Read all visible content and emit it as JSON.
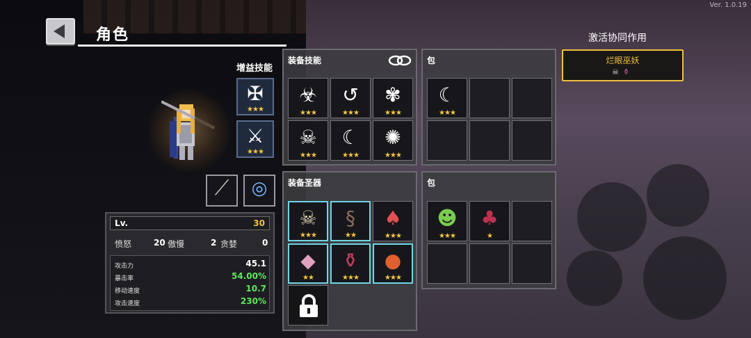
{
  "version": "Ver. 1.0.19",
  "header": {
    "title": "角色"
  },
  "buff": {
    "label": "增益技能",
    "slots": [
      {
        "icon": "demon-sigil-icon",
        "glyph": "✠",
        "stars": "★★★"
      },
      {
        "icon": "sword-arrow-icon",
        "glyph": "⚔",
        "stars": "★★★"
      }
    ]
  },
  "equipped": [
    {
      "icon": "spear-icon",
      "glyph": "⟋"
    },
    {
      "icon": "whirl-shield-icon",
      "glyph": "◎"
    }
  ],
  "stats": {
    "lv_label": "Lv.",
    "lv_value": "30",
    "traits": [
      {
        "name": "愤怒",
        "value": "20"
      },
      {
        "name": "傲慢",
        "value": "2"
      },
      {
        "name": "贪婪",
        "value": "0"
      }
    ],
    "rows": [
      {
        "name": "攻击力",
        "value": "45.1",
        "color": "#ffffff"
      },
      {
        "name": "暴击率",
        "value": "54.00%",
        "color": "#5ee65e"
      },
      {
        "name": "移动速度",
        "value": "10.7",
        "color": "#5ee65e"
      },
      {
        "name": "攻击速度",
        "value": "230%",
        "color": "#5ee65e"
      }
    ]
  },
  "skills_panel": {
    "title": "装备技能",
    "slots": [
      {
        "icon": "biohazard-icon",
        "glyph": "☣",
        "stars": "★★★"
      },
      {
        "icon": "axe-swirl-icon",
        "glyph": "↺",
        "stars": "★★★"
      },
      {
        "icon": "goblin-icon",
        "glyph": "✾",
        "stars": "★★★"
      },
      {
        "icon": "skull-icon",
        "glyph": "☠",
        "stars": "★★★"
      },
      {
        "icon": "crescent-icon",
        "glyph": "☾",
        "stars": "★★★"
      },
      {
        "icon": "burst-icon",
        "glyph": "✺",
        "stars": "★★★"
      }
    ]
  },
  "skills_bag": {
    "title": "包",
    "slots": [
      {
        "icon": "crescent-icon",
        "glyph": "☾",
        "stars": "★★★"
      },
      null,
      null,
      null,
      null,
      null
    ]
  },
  "relics_panel": {
    "title": "装备圣器",
    "slots": [
      {
        "icon": "skull-mask-icon",
        "glyph": "☠",
        "stars": "★★★",
        "highlight": true
      },
      {
        "icon": "serpent-icon",
        "glyph": "§",
        "stars": "★★",
        "highlight": true
      },
      {
        "icon": "flame-leaf-icon",
        "glyph": "♠",
        "stars": "★★★",
        "highlight": false
      },
      {
        "icon": "crystal-icon",
        "glyph": "◆",
        "stars": "★★",
        "highlight": true
      },
      {
        "icon": "potion-icon",
        "glyph": "⚱",
        "stars": "★★★",
        "highlight": true
      },
      {
        "icon": "egg-icon",
        "glyph": "●",
        "stars": "★★★",
        "highlight": true
      }
    ],
    "locked_icon": "padlock-icon"
  },
  "relics_bag": {
    "title": "包",
    "slots": [
      {
        "icon": "green-mask-icon",
        "glyph": "☻",
        "stars": "★★★"
      },
      {
        "icon": "red-claw-icon",
        "glyph": "♣",
        "stars": "★"
      },
      null,
      null,
      null,
      null,
      null,
      null
    ]
  },
  "synergy": {
    "title": "激活协同作用",
    "card_name": "烂眼巫妖",
    "card_icons": [
      "skull-icon",
      "potion-icon"
    ]
  }
}
